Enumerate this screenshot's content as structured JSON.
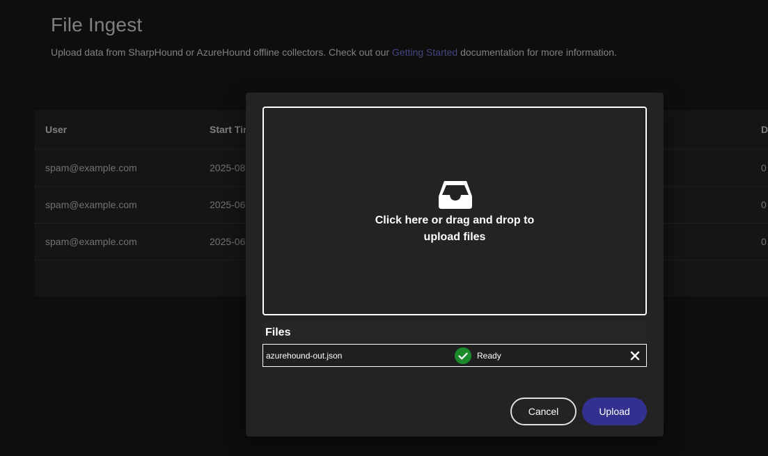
{
  "page": {
    "title": "File Ingest",
    "description_prefix": "Upload data from SharpHound or AzureHound offline collectors. Check out our ",
    "description_link": "Getting Started",
    "description_suffix": " documentation for more information."
  },
  "table": {
    "headers": {
      "user": "User",
      "start_time": "Start Tir",
      "d": "D"
    },
    "rows": [
      {
        "user": "spam@example.com",
        "start_time": "2025-08",
        "d": "0"
      },
      {
        "user": "spam@example.com",
        "start_time": "2025-06",
        "d": "0"
      },
      {
        "user": "spam@example.com",
        "start_time": "2025-06",
        "d": "0"
      }
    ]
  },
  "dialog": {
    "dropzone_text_line1": "Click here or drag and drop to",
    "dropzone_text_line2": "upload files",
    "files_label": "Files",
    "file": {
      "name": "azurehound-out.json",
      "status": "Ready",
      "status_icon": "check-circle-icon"
    },
    "cancel_label": "Cancel",
    "upload_label": "Upload"
  },
  "colors": {
    "accent": "#33318f",
    "link": "#8b8dff",
    "success": "#1b8a2a"
  }
}
